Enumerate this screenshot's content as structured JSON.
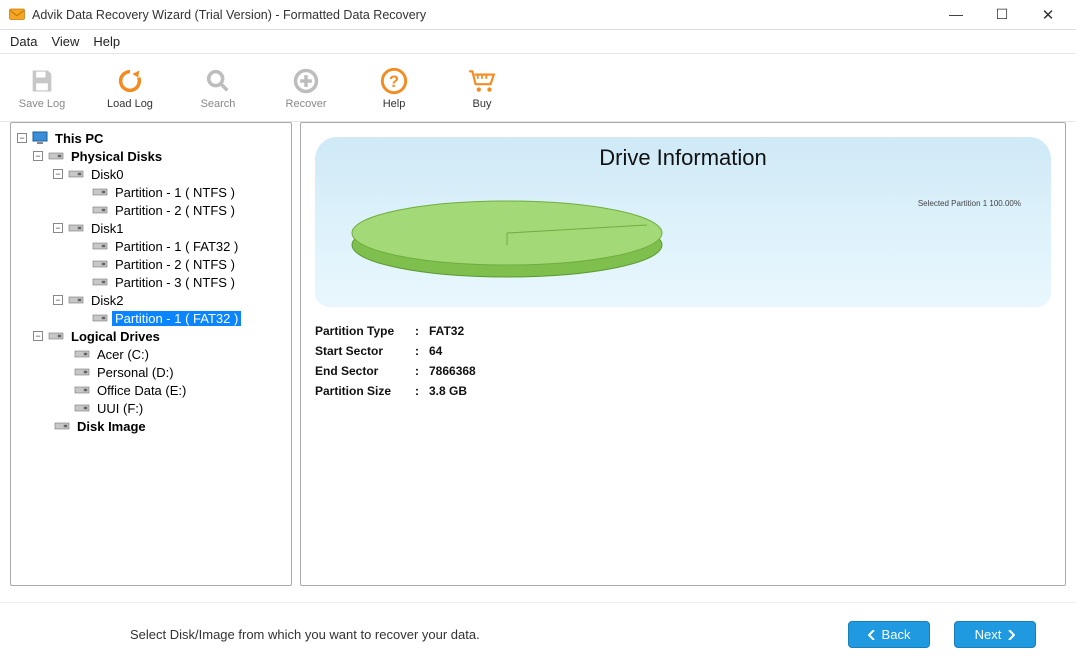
{
  "window": {
    "title": "Advik Data Recovery Wizard (Trial Version) - Formatted Data Recovery"
  },
  "menubar": {
    "items": [
      "Data",
      "View",
      "Help"
    ]
  },
  "toolbar": {
    "save_log": "Save Log",
    "load_log": "Load Log",
    "search": "Search",
    "recover": "Recover",
    "help": "Help",
    "buy": "Buy"
  },
  "tree": {
    "root": "This PC",
    "phys": "Physical Disks",
    "disk0": "Disk0",
    "d0p1": "Partition - 1 ( NTFS )",
    "d0p2": "Partition - 2 ( NTFS )",
    "disk1": "Disk1",
    "d1p1": "Partition - 1 ( FAT32 )",
    "d1p2": "Partition - 2 ( NTFS )",
    "d1p3": "Partition - 3 ( NTFS )",
    "disk2": "Disk2",
    "d2p1": "Partition - 1 ( FAT32 )",
    "logical": "Logical Drives",
    "acer": "Acer (C:)",
    "personal": "Personal (D:)",
    "office": "Office Data (E:)",
    "uui": "UUI (F:)",
    "diskimage": "Disk Image"
  },
  "info": {
    "title": "Drive Information",
    "legend": "Selected Partition 1 100.00%",
    "rows": {
      "ptype_k": "Partition Type",
      "ptype_v": "FAT32",
      "ssec_k": "Start Sector",
      "ssec_v": "64",
      "esec_k": "End Sector",
      "esec_v": "7866368",
      "psize_k": "Partition Size",
      "psize_v": "3.8 GB"
    }
  },
  "footer": {
    "hint": "Select Disk/Image from which you want to recover your data.",
    "back": "Back",
    "next": "Next"
  },
  "chart_data": {
    "type": "pie",
    "title": "Drive Information",
    "series": [
      {
        "name": "Selected Partition 1",
        "values": [
          100.0
        ]
      }
    ],
    "categories": [
      "Selected Partition 1"
    ],
    "values_pct": [
      100.0
    ]
  }
}
